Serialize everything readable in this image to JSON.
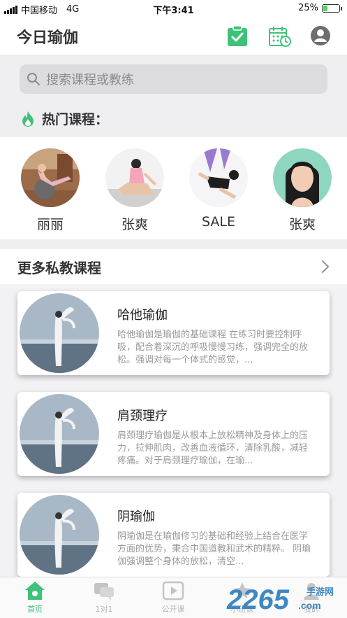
{
  "status_bar": {
    "carrier": "中国移动",
    "network": "4G",
    "time": "下午3:41",
    "battery": "25%",
    "battery_level": 0.25
  },
  "header": {
    "title": "今日瑜伽",
    "icons": [
      "clipboard-check-icon",
      "calendar-clock-icon",
      "user-icon"
    ]
  },
  "search": {
    "placeholder": "搜索课程或教练"
  },
  "hot_courses": {
    "title": "热门课程：",
    "icon": "flame-icon",
    "trainers": [
      {
        "name": "丽丽"
      },
      {
        "name": "张爽"
      },
      {
        "name": "SALE"
      },
      {
        "name": "张爽"
      }
    ]
  },
  "private_courses": {
    "title": "更多私教课程",
    "items": [
      {
        "title": "哈他瑜伽",
        "desc": "哈他瑜伽是瑜伽的基础课程 在练习时要控制呼吸，配合着深沉的呼吸慢慢习练，强调完全的放松。强调对每一个体式的感觉，..."
      },
      {
        "title": "肩颈理疗",
        "desc": "肩颈理疗瑜伽是从根本上放松精神及身体上的压力，拉伸肌肉，改善血液循环，清除乳酸，减轻疼痛。对于肩颈理疗瑜伽，在瑜..."
      },
      {
        "title": "阴瑜伽",
        "desc": "阴瑜伽是在瑜伽修习的基础和经验上结合在医学方面的优势，秉合中国道教和武术的精粹。 阴瑜伽强调整个身体的放松，清空..."
      }
    ]
  },
  "tabs": [
    {
      "label": "首页",
      "icon": "home-icon",
      "active": true
    },
    {
      "label": "1对1",
      "icon": "chat-icon",
      "active": false
    },
    {
      "label": "公开课",
      "icon": "play-icon",
      "active": false
    },
    {
      "label": "小班课",
      "icon": "star-icon",
      "active": false
    },
    {
      "label": "我的",
      "icon": "profile-icon",
      "active": false
    }
  ],
  "watermark": {
    "text": "2265",
    "suffix": ".com",
    "site": "手游网"
  },
  "colors": {
    "accent": "#3ec27a",
    "background_gray": "#efeff2"
  }
}
